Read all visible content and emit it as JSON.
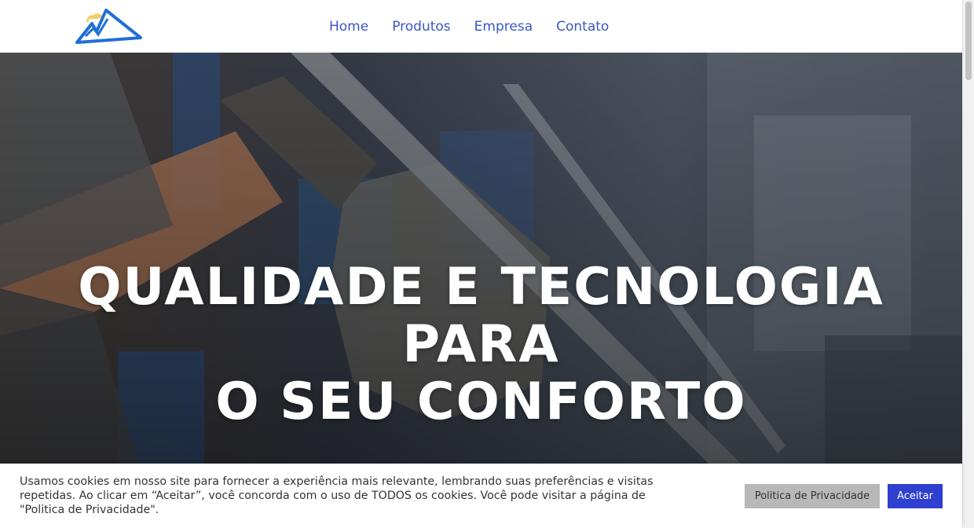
{
  "header": {
    "logo_icon": "mountain-logo-icon",
    "nav": [
      {
        "label": "Home"
      },
      {
        "label": "Produtos"
      },
      {
        "label": "Empresa"
      },
      {
        "label": "Contato"
      }
    ]
  },
  "hero": {
    "title_line1": "QUALIDADE E TECNOLOGIA PARA",
    "title_line2": "O SEU CONFORTO"
  },
  "cookie_banner": {
    "text": "Usamos cookies em nosso site para fornecer a experiência mais relevante, lembrando suas preferências e visitas repetidas. Ao clicar em “Aceitar”, você concorda com o uso de TODOS os cookies. Você pode visitar a página de \"Politica de Privacidade\".",
    "privacy_button": "Politica de Privacidade",
    "accept_button": "Aceitar"
  },
  "colors": {
    "nav_link": "#3a55c9",
    "accept_button": "#2f3fd0",
    "privacy_button": "#b8b8b8"
  }
}
